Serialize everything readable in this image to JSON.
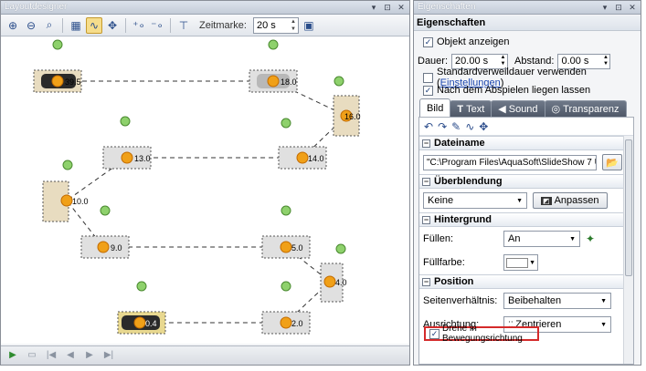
{
  "left_pane": {
    "title": "Layoutdesigner",
    "title_buttons": [
      "▾",
      "⊡",
      "✕"
    ],
    "zeitmarke_label": "Zeitmarke:",
    "zeitmarke_value": "20 s",
    "canvas_labels": [
      "39.5",
      "18.0",
      "16.0",
      "13.0",
      "14.0",
      "10.0",
      "9.0",
      "5.0",
      "4.0",
      "0.4",
      "2.0"
    ]
  },
  "right_pane": {
    "title": "Eigenschaften",
    "title_buttons": [
      "▾",
      "⊡",
      "✕"
    ],
    "header": "Eigenschaften",
    "objekt_anzeigen": "Objekt anzeigen",
    "dauer_label": "Dauer:",
    "dauer_value": "20.00 s",
    "abstand_label": "Abstand:",
    "abstand_value": "0.00 s",
    "standard_label": "Standardverweildauer verwenden (",
    "standard_link": "Einstellungen",
    "standard_close": ")",
    "nach_abspielen": "Nach dem Abspielen liegen lassen",
    "tabs": [
      "Bild",
      "Text",
      "Sound",
      "Transparenz"
    ],
    "dateiname_header": "Dateiname",
    "dateiname_value": "\"C:\\Program Files\\AquaSoft\\SlideShow 7 Ultimat",
    "ueberblendung_header": "Überblendung",
    "ueberblendung_value": "Keine",
    "anpassen_button": "Anpassen",
    "hintergrund_header": "Hintergrund",
    "fuellen_label": "Füllen:",
    "fuellen_value": "An",
    "fuellfarbe_label": "Füllfarbe:",
    "position_header": "Position",
    "seitenverhaeltnis_label": "Seitenverhältnis:",
    "seitenverhaeltnis_value": "Beibehalten",
    "ausrichtung_label": "Ausrichtung:",
    "ausrichtung_value": "Zentrieren",
    "drehe_label": "Drehe in Bewegungsrichtung"
  }
}
